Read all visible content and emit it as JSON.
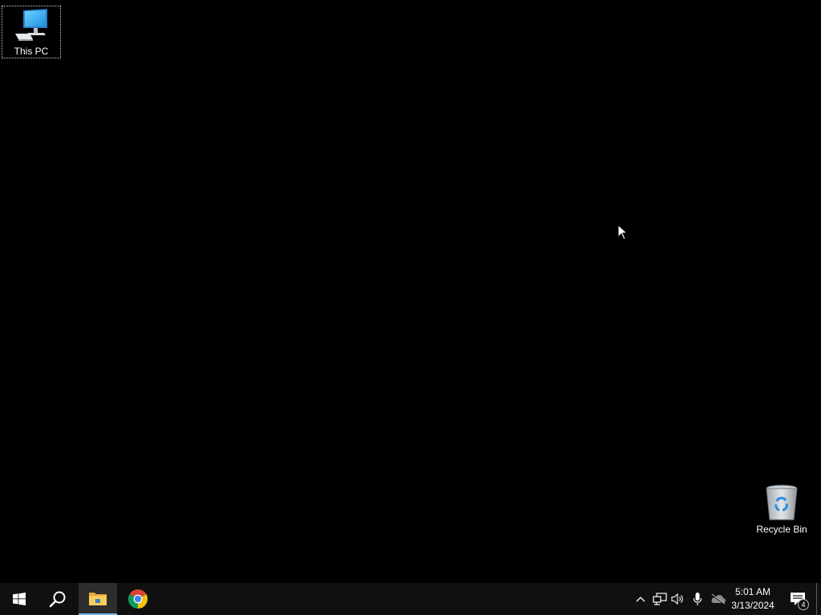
{
  "desktop": {
    "icons": [
      {
        "label": "This PC",
        "icon": "computer-monitor-icon",
        "selected": true
      },
      {
        "label": "Recycle Bin",
        "icon": "recycle-bin-icon",
        "selected": false
      }
    ],
    "background_color": "#000000"
  },
  "taskbar": {
    "background_color": "#101010",
    "start_icon": "windows-logo-icon",
    "search_icon": "magnifier-icon",
    "pinned_apps": [
      {
        "name": "File Explorer",
        "icon": "folder-icon",
        "active": true
      },
      {
        "name": "Google Chrome",
        "icon": "chrome-icon",
        "active": false
      }
    ],
    "active_indicator_color": "#76b9ed",
    "tray": {
      "icons": [
        "chevron-up-icon",
        "network-icon",
        "volume-icon",
        "microphone-icon",
        "onedrive-icon"
      ],
      "time": "5:01 AM",
      "date": "3/13/2024",
      "notification_count": "4"
    }
  }
}
